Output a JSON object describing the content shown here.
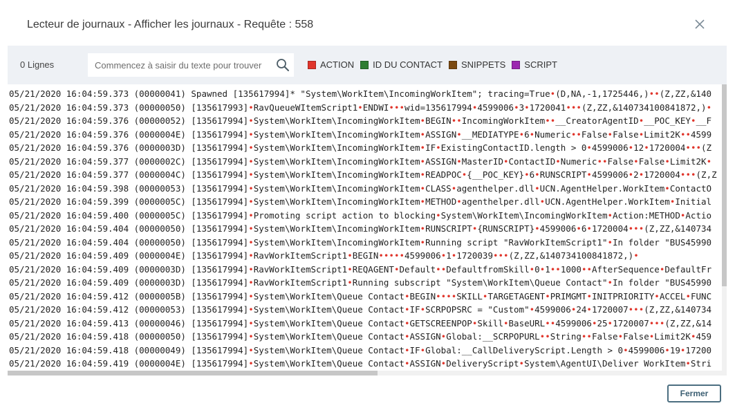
{
  "dialog": {
    "title": "Lecteur de journaux - Afficher les journaux - Requête : 558",
    "close_label": "Fermer"
  },
  "toolbar": {
    "line_count": "0 Lignes",
    "search_placeholder": "Commencez à saisir du texte pour trouver",
    "legend": [
      {
        "label": "ACTION",
        "color": "#e0352b"
      },
      {
        "label": "ID DU CONTACT",
        "color": "#2e7d32"
      },
      {
        "label": "SNIPPETS",
        "color": "#7b4a12"
      },
      {
        "label": "SCRIPT",
        "color": "#9c27b0"
      }
    ]
  },
  "log": {
    "separator_color": "#e0352b",
    "lines": [
      "05/21/2020 16:04:59.373 (00000041) Spawned [135617994]* \"System\\WorkItem\\IncomingWorkItem\"; tracing=True•(D,NA,-1,1725446,)••(Z,ZZ,&140",
      "05/21/2020 16:04:59.373 (00000050) [135617993]•RavQueueWItemScript1•ENDWI•••wid=135617994•4599006•3•1720041•••(Z,ZZ,&140734100841872,)•",
      "05/21/2020 16:04:59.376 (00000052) [135617994]•System\\WorkItem\\IncomingWorkItem•BEGIN••IncomingWorkItem••__CreatorAgentID•__POC_KEY•__F",
      "05/21/2020 16:04:59.376 (0000004E) [135617994]•System\\WorkItem\\IncomingWorkItem•ASSIGN•__MEDIATYPE•6•Numeric••False•False•Limit2K••4599",
      "05/21/2020 16:04:59.376 (0000003D) [135617994]•System\\WorkItem\\IncomingWorkItem•IF•ExistingContactID.length > 0•4599006•12•1720004•••(Z",
      "05/21/2020 16:04:59.377 (0000002C) [135617994]•System\\WorkItem\\IncomingWorkItem•ASSIGN•MasterID•ContactID•Numeric••False•False•Limit2K•",
      "05/21/2020 16:04:59.377 (0000004C) [135617994]•System\\WorkItem\\IncomingWorkItem•READPOC•{__POC_KEY}•6•RUNSCRIPT•4599006•2•1720004•••(Z,Z",
      "05/21/2020 16:04:59.398 (00000053) [135617994]•System\\WorkItem\\IncomingWorkItem•CLASS•agenthelper.dll•UCN.AgentHelper.WorkItem•ContactO",
      "05/21/2020 16:04:59.399 (0000005C) [135617994]•System\\WorkItem\\IncomingWorkItem•METHOD•agenthelper.dll•UCN.AgentHelper.WorkItem•Initial",
      "05/21/2020 16:04:59.400 (0000005C) [135617994]•Promoting script action to blocking•System\\WorkItem\\IncomingWorkItem•Action:METHOD•Actio",
      "05/21/2020 16:04:59.404 (00000050) [135617994]•System\\WorkItem\\IncomingWorkItem•RUNSCRIPT•{RUNSCRIPT}•4599006•6•1720004•••(Z,ZZ,&140734",
      "05/21/2020 16:04:59.404 (00000050) [135617994]•System\\WorkItem\\IncomingWorkItem•Running script \"RavWorkItemScript1\"•In folder \"BUS45990",
      "05/21/2020 16:04:59.409 (0000004E) [135617994]•RavWorkItemScript1•BEGIN•••••4599006•1•1720039•••(Z,ZZ,&140734100841872,)•",
      "05/21/2020 16:04:59.409 (0000003D) [135617994]•RavWorkItemScript1•REQAGENT•Default••DefaultfromSkill•0•1••1000••AfterSequence•DefaultFr",
      "05/21/2020 16:04:59.409 (0000003D) [135617994]•RavWorkItemScript1•Running subscript \"System\\WorkItem\\Queue Contact\"•In folder \"BUS45990",
      "05/21/2020 16:04:59.412 (0000005B) [135617994]•System\\WorkItem\\Queue Contact•BEGIN••••SKILL•TARGETAGENT•PRIMGMT•INITPRIORITY•ACCEL•FUNC",
      "05/21/2020 16:04:59.412 (00000053) [135617994]•System\\WorkItem\\Queue Contact•IF•SCRPOPSRC = \"Custom\"•4599006•24•1720007•••(Z,ZZ,&140734",
      "05/21/2020 16:04:59.413 (00000046) [135617994]•System\\WorkItem\\Queue Contact•GETSCREENPOP•Skill•BaseURL••4599006•25•1720007•••(Z,ZZ,&14",
      "05/21/2020 16:04:59.418 (00000050) [135617994]•System\\WorkItem\\Queue Contact•ASSIGN•Global:__SCRPOPURL••String••False•False•Limit2K•459",
      "05/21/2020 16:04:59.418 (00000049) [135617994]•System\\WorkItem\\Queue Contact•IF•Global:__CallDeliveryScript.Length > 0•4599006•19•17200",
      "05/21/2020 16:04:59.419 (0000004E) [135617994]•System\\WorkItem\\Queue Contact•ASSIGN•DeliveryScript•System\\AgentUI\\Deliver WorkItem•Stri"
    ]
  }
}
